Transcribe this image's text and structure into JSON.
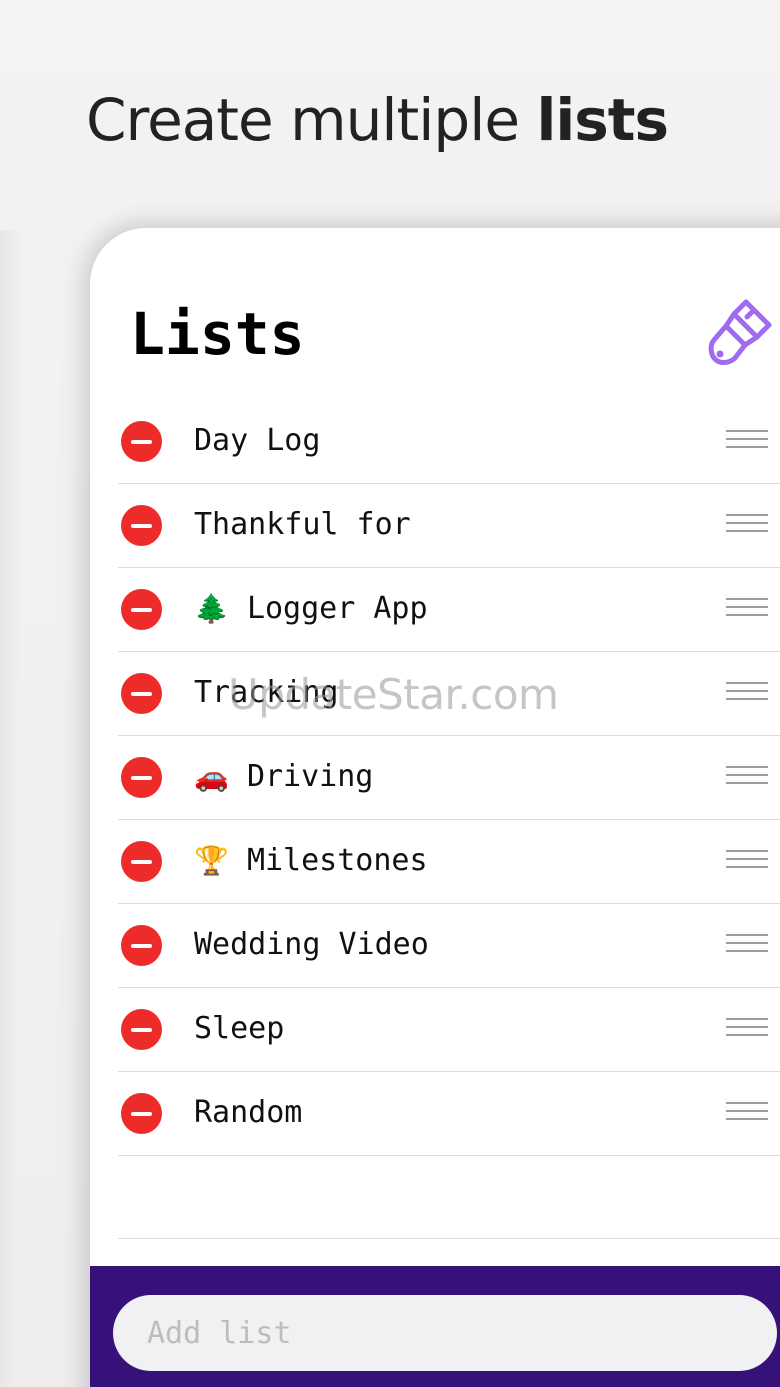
{
  "headline": {
    "text_regular": "Create multiple ",
    "text_bold": "lists"
  },
  "screen": {
    "title": "Lists",
    "accent_color": "#a06bf0",
    "items": [
      {
        "emoji": "",
        "label": "Day Log"
      },
      {
        "emoji": "",
        "label": "Thankful for"
      },
      {
        "emoji": "🌲",
        "label": "Logger App"
      },
      {
        "emoji": "",
        "label": "Tracking"
      },
      {
        "emoji": "🚗",
        "label": "Driving"
      },
      {
        "emoji": "🏆",
        "label": "Milestones"
      },
      {
        "emoji": "",
        "label": "Wedding Video"
      },
      {
        "emoji": "",
        "label": "Sleep"
      },
      {
        "emoji": "",
        "label": "Random"
      }
    ],
    "add_input": {
      "placeholder": "Add list",
      "value": ""
    },
    "bottom_bar_color": "#37117a",
    "delete_color": "#ee2b2b"
  },
  "watermark": "UpdateStar.com"
}
